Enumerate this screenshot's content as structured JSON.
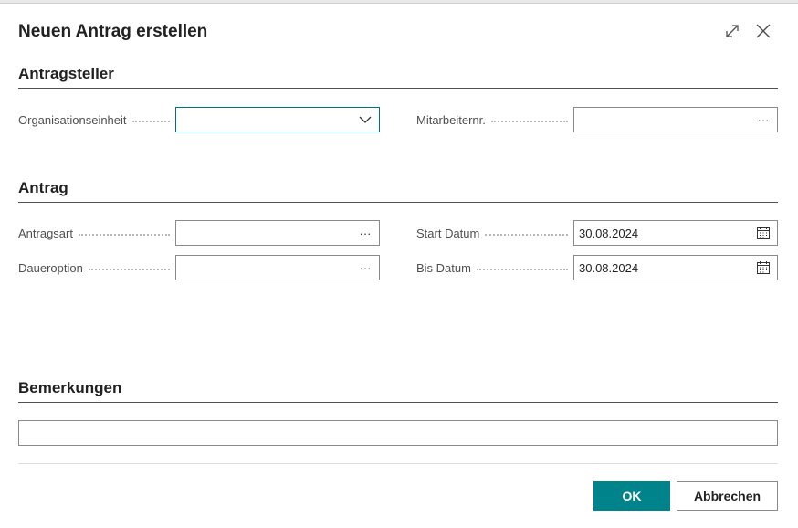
{
  "dialog": {
    "title": "Neuen Antrag erstellen",
    "expand_icon": "expand-icon",
    "close_icon": "close-icon"
  },
  "sections": {
    "antragsteller": {
      "title": "Antragsteller",
      "org_label": "Organisationseinheit",
      "org_value": "",
      "mitarbeiter_label": "Mitarbeiternr.",
      "mitarbeiter_value": ""
    },
    "antrag": {
      "title": "Antrag",
      "antragsart_label": "Antragsart",
      "antragsart_value": "",
      "daueroption_label": "Daueroption",
      "daueroption_value": "",
      "start_label": "Start Datum",
      "start_value": "30.08.2024",
      "bis_label": "Bis Datum",
      "bis_value": "30.08.2024"
    },
    "bemerkungen": {
      "title": "Bemerkungen",
      "value": ""
    }
  },
  "lookup_glyph": "···",
  "buttons": {
    "ok": "OK",
    "cancel": "Abbrechen"
  },
  "colors": {
    "accent": "#00838a",
    "focus_border": "#00727a"
  }
}
